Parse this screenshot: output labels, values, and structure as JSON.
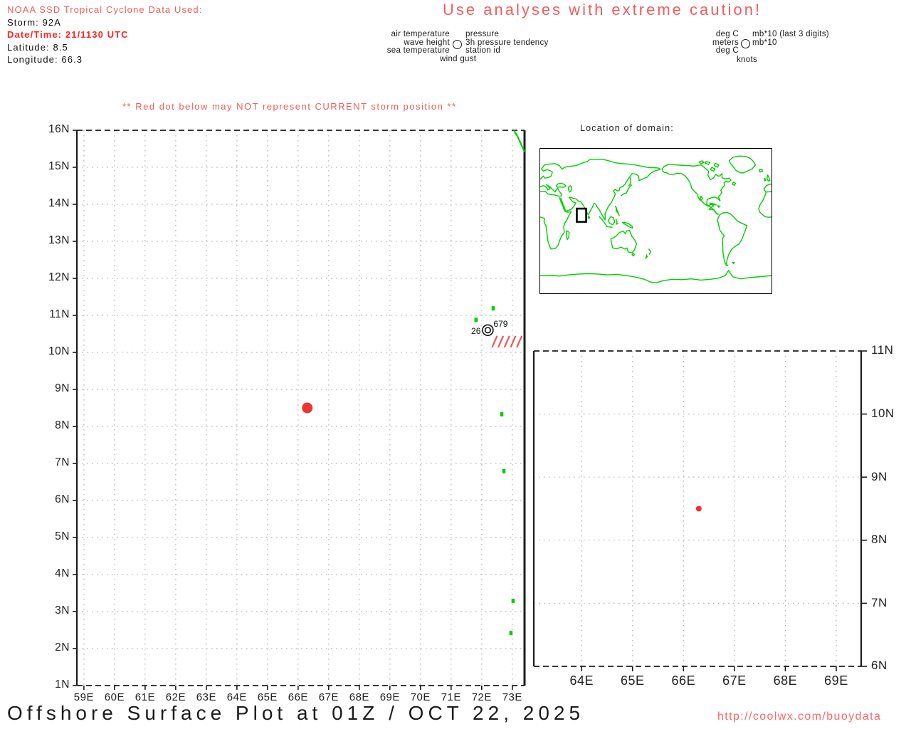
{
  "header": {
    "storm_info": {
      "title": "NOAA SSD Tropical Cyclone Data Used:",
      "storm": "Storm: 92A",
      "datetime": "Date/Time: 21/1130 UTC",
      "latitude": "Latitude: 8.5",
      "longitude": "Longitude: 66.3"
    },
    "caution": "Use analyses with extreme caution!",
    "station_legend": {
      "left": [
        "air temperature",
        "wave height",
        "sea temperature"
      ],
      "right": [
        "pressure",
        "3h pressure tendency",
        "station id"
      ],
      "bottom": "wind gust"
    },
    "units_legend": {
      "left": [
        "deg C",
        "meters",
        "deg C"
      ],
      "right": [
        "mb*10 (last 3 digits)",
        "mb*10"
      ],
      "bottom": "knots"
    }
  },
  "warning": "** Red dot below may NOT represent CURRENT storm position **",
  "footer": {
    "title": "Offshore Surface Plot at 01Z / OCT 22, 2025",
    "url": "http://coolwx.com/buoydata"
  },
  "colors": {
    "storm_dot": "#ee3333",
    "soft_red": "#f25c5c",
    "strong_red": "#ff2424",
    "hatch_red": "#f25555",
    "coast_green": "#00cf00",
    "grid_gray": "#b5b5b5",
    "axis_black": "#1c1c1c"
  },
  "chart_data": [
    {
      "type": "scatter",
      "name": "main-surface-plot",
      "x_tick_values": [
        59,
        60,
        61,
        62,
        63,
        64,
        65,
        66,
        67,
        68,
        69,
        70,
        71,
        72,
        73
      ],
      "x_tick_labels": [
        "59E",
        "60E",
        "61E",
        "62E",
        "63E",
        "64E",
        "65E",
        "66E",
        "67E",
        "68E",
        "69E",
        "70E",
        "71E",
        "72E",
        "73E"
      ],
      "y_tick_values": [
        1,
        2,
        3,
        4,
        5,
        6,
        7,
        8,
        9,
        10,
        11,
        12,
        13,
        14,
        15,
        16
      ],
      "y_tick_labels": [
        "1N",
        "2N",
        "3N",
        "4N",
        "5N",
        "6N",
        "7N",
        "8N",
        "9N",
        "10N",
        "11N",
        "12N",
        "13N",
        "14N",
        "15N",
        "16N"
      ],
      "xlim": [
        58.77,
        73.4
      ],
      "ylim": [
        1,
        16
      ],
      "grid": true,
      "points": [
        {
          "name": "storm-position-dot",
          "lon": 66.3,
          "lat": 8.5,
          "color": "#ee3333"
        }
      ],
      "station_plot": {
        "left_value": "26",
        "top_right_value": "679",
        "lon": 72.2,
        "lat": 10.6,
        "hatch_slashes": 5
      },
      "islands_lonlat": [
        [
          72.37,
          11.19
        ],
        [
          71.81,
          10.88
        ],
        [
          72.65,
          8.33
        ],
        [
          72.72,
          6.79
        ],
        [
          73.02,
          3.29
        ],
        [
          72.95,
          2.42
        ]
      ],
      "coastline_lonlat": [
        [
          73.05,
          16
        ],
        [
          73.18,
          15.82
        ],
        [
          73.3,
          15.6
        ],
        [
          73.4,
          15.42
        ]
      ]
    },
    {
      "type": "map",
      "name": "location-of-domain-inset",
      "title": "Location of domain:",
      "lon_origin": 3,
      "domain_box": {
        "lon_min": 60,
        "lon_max": 74.5,
        "lat_min": -1,
        "lat_max": 15.5
      }
    },
    {
      "type": "scatter",
      "name": "storm-zoom-plot",
      "x_tick_values": [
        64,
        65,
        66,
        67,
        68,
        69
      ],
      "x_tick_labels": [
        "64E",
        "65E",
        "66E",
        "67E",
        "68E",
        "69E"
      ],
      "y_tick_values": [
        6,
        7,
        8,
        9,
        10,
        11
      ],
      "y_tick_labels": [
        "6N",
        "7N",
        "8N",
        "9N",
        "10N",
        "11N"
      ],
      "xlim": [
        63.06,
        69.49
      ],
      "ylim": [
        6,
        11
      ],
      "grid": true,
      "points": [
        {
          "name": "storm-position-dot",
          "lon": 66.3,
          "lat": 8.5,
          "color": "#ee3333"
        }
      ]
    }
  ]
}
